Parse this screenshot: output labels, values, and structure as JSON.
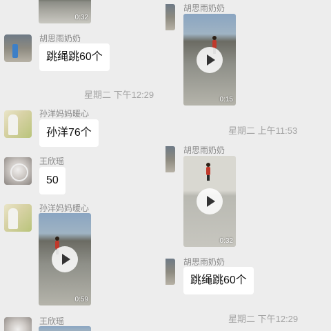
{
  "left": {
    "video_top": {
      "duration": "0:32"
    },
    "msg1": {
      "name": "胡思雨奶奶",
      "text": "跳绳跳60个"
    },
    "time1": "星期二 下午12:29",
    "msg2": {
      "name": "孙洋妈妈暖心",
      "text": "孙洋76个"
    },
    "msg3": {
      "name": "王欣瑶",
      "text": "50"
    },
    "msg4": {
      "name": "孙洋妈妈暖心",
      "video_duration": "0:59"
    },
    "msg5": {
      "name": "王欣瑶"
    }
  },
  "right": {
    "msg1": {
      "name": "胡思雨奶奶",
      "video_duration": "0:15"
    },
    "time1": "星期二 上午11:53",
    "msg2": {
      "name": "胡思雨奶奶",
      "video_duration": "0:32"
    },
    "msg3": {
      "name": "胡思雨奶奶",
      "text": "跳绳跳60个"
    },
    "time2": "星期二 下午12:29"
  },
  "colors": {
    "background": "#ededed",
    "bubble": "#ffffff",
    "timestamp": "#a3a3a3",
    "name": "#8a8a8a"
  }
}
